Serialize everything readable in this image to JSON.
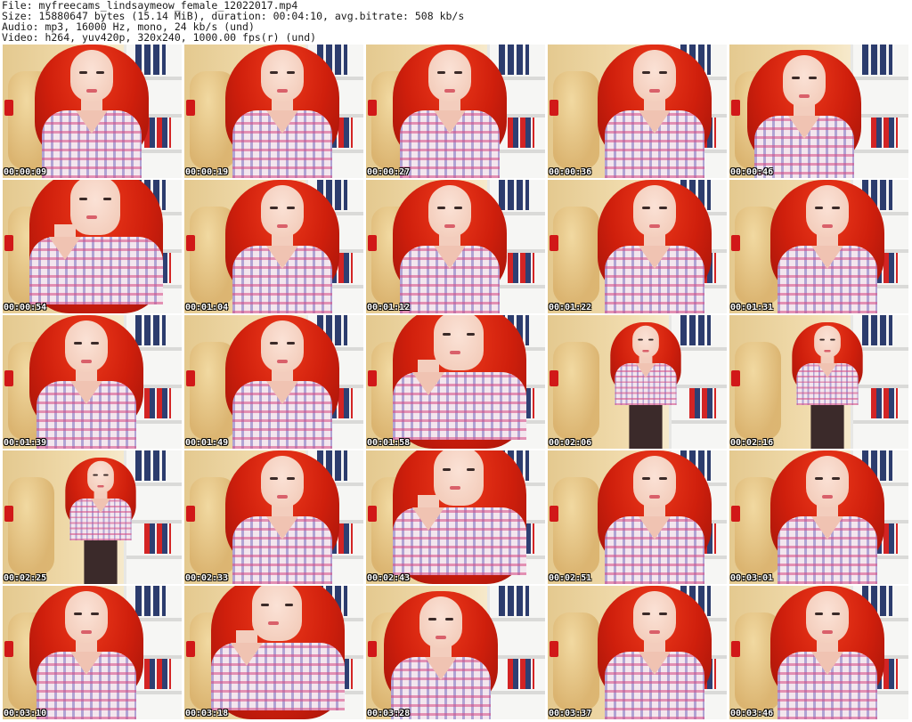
{
  "header": {
    "file": "File: myfreecams_lindsaymeow_female_12022017.mp4",
    "size": "Size: 15880647 bytes (15.14 MiB), duration: 00:04:10, avg.bitrate: 508 kb/s",
    "audio": "Audio: mp3, 16000 Hz, mono, 24 kb/s (und)",
    "video": "Video: h264, yuv420p, 320x240, 1000.00 fps(r) (und)"
  },
  "thumbnails": [
    {
      "timecode": "00:00:09"
    },
    {
      "timecode": "00:00:19"
    },
    {
      "timecode": "00:00:27"
    },
    {
      "timecode": "00:00:36"
    },
    {
      "timecode": "00:00:46"
    },
    {
      "timecode": "00:00:54"
    },
    {
      "timecode": "00:01:04"
    },
    {
      "timecode": "00:01:12"
    },
    {
      "timecode": "00:01:22"
    },
    {
      "timecode": "00:01:31"
    },
    {
      "timecode": "00:01:39"
    },
    {
      "timecode": "00:01:49"
    },
    {
      "timecode": "00:01:58"
    },
    {
      "timecode": "00:02:06"
    },
    {
      "timecode": "00:02:16"
    },
    {
      "timecode": "00:02:25"
    },
    {
      "timecode": "00:02:33"
    },
    {
      "timecode": "00:02:43"
    },
    {
      "timecode": "00:02:51"
    },
    {
      "timecode": "00:03:01"
    },
    {
      "timecode": "00:03:10"
    },
    {
      "timecode": "00:03:18"
    },
    {
      "timecode": "00:03:28"
    },
    {
      "timecode": "00:03:37"
    },
    {
      "timecode": "00:03:46"
    }
  ]
}
